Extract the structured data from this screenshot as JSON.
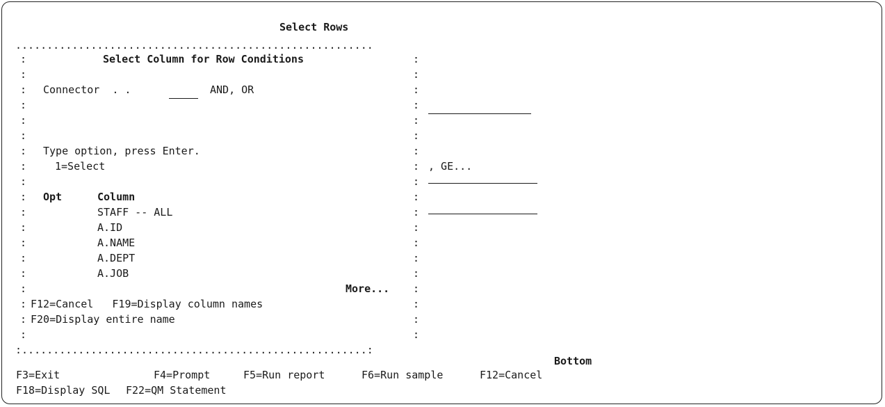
{
  "screen": {
    "title": "Select Rows",
    "bottom_indicator": "Bottom",
    "right_partial": [
      ", GE..."
    ],
    "function_keys_row1": [
      "F3=Exit",
      "F4=Prompt",
      "F5=Run report",
      "F6=Run sample",
      "F12=Cancel"
    ],
    "function_keys_row2": [
      "F18=Display SQL",
      "F22=QM Statement"
    ]
  },
  "popup": {
    "top_border": ".........................................................",
    "bottom_border": ":.......................................................:",
    "colon": ":",
    "title": "Select Column for Row Conditions",
    "connector_label": "Connector  . .",
    "connector_value": "",
    "connector_hint": "AND, OR",
    "instruction": "Type option, press Enter.",
    "option_1": "1=Select",
    "header_opt": "Opt",
    "header_column": "Column",
    "rows": [
      "STAFF -- ALL",
      "A.ID",
      "A.NAME",
      "A.DEPT",
      "A.JOB"
    ],
    "more": "More...",
    "keys_line1": "F12=Cancel   F19=Display column names",
    "keys_line2": "F20=Display entire name"
  }
}
